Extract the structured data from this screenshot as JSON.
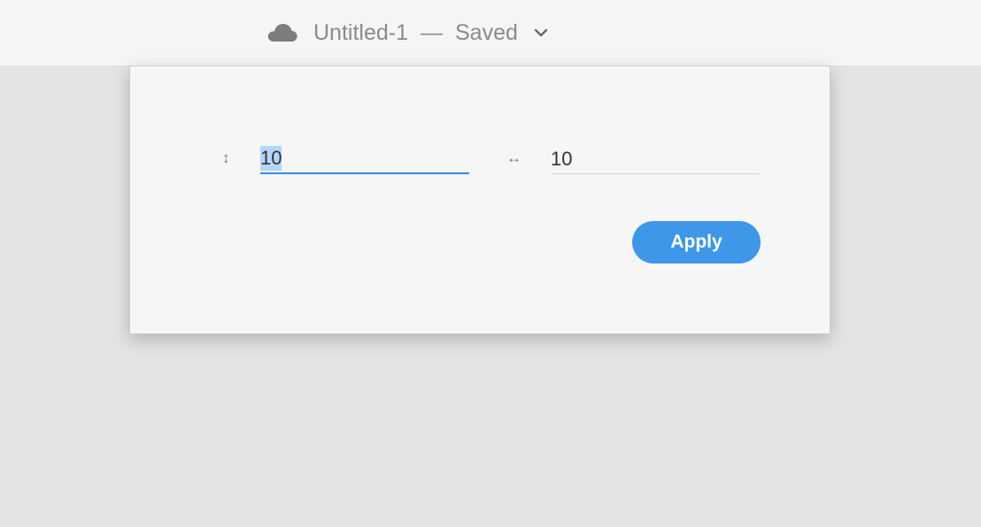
{
  "header": {
    "icon": "cloud-icon",
    "document_name": "Untitled-1",
    "separator": "—",
    "status": "Saved",
    "menu_icon": "chevron-down-icon"
  },
  "dialog": {
    "height_icon": "↕",
    "height_value": "10",
    "width_icon": "↔",
    "width_value": "10",
    "apply_label": "Apply"
  },
  "colors": {
    "accent": "#3f97ea",
    "focus_underline": "#2d8ceb",
    "selection": "#b3d7fc"
  }
}
